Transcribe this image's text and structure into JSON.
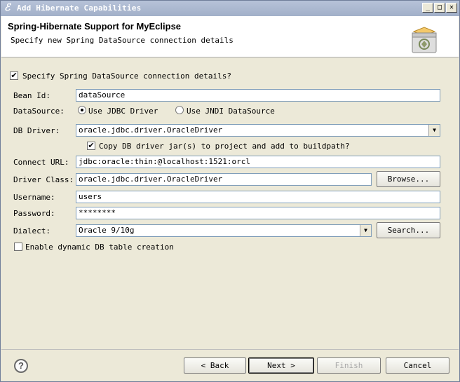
{
  "window": {
    "title": "Add Hibernate Capabilities",
    "app_icon": "eclipse-icon"
  },
  "header": {
    "title": "Spring-Hibernate Support for MyEclipse",
    "description": "Specify new Spring DataSource connection details"
  },
  "form": {
    "specify_checkbox_label": "Specify Spring DataSource connection details?",
    "specify_checked": true,
    "bean_id_label": "Bean Id:",
    "bean_id_value": "dataSource",
    "datasource_label": "DataSource:",
    "radio_jdbc_label": "Use JDBC Driver",
    "radio_jndi_label": "Use JNDI DataSource",
    "radio_selected": "jdbc",
    "db_driver_label": "DB Driver:",
    "db_driver_value": "oracle.jdbc.driver.OracleDriver",
    "copy_jar_label": "Copy DB driver jar(s) to project and add to buildpath?",
    "copy_jar_checked": true,
    "connect_url_label": "Connect URL:",
    "connect_url_value": "jdbc:oracle:thin:@localhost:1521:orcl",
    "driver_class_label": "Driver Class:",
    "driver_class_value": "oracle.jdbc.driver.OracleDriver",
    "browse_label": "Browse...",
    "username_label": "Username:",
    "username_value": "users",
    "password_label": "Password:",
    "password_value": "********",
    "dialect_label": "Dialect:",
    "dialect_value": "Oracle 9/10g",
    "search_label": "Search...",
    "dynamic_label": "Enable dynamic DB table creation",
    "dynamic_checked": false
  },
  "footer": {
    "back_label": "< Back",
    "next_label": "Next >",
    "finish_label": "Finish",
    "cancel_label": "Cancel"
  }
}
